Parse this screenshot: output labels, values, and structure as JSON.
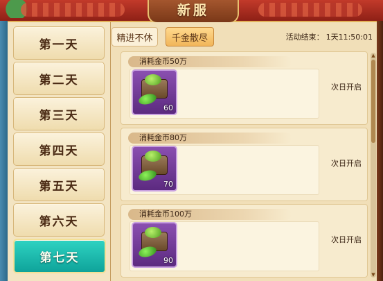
{
  "header": {
    "title": "新服"
  },
  "sidebar": {
    "days": [
      {
        "label": "第一天",
        "active": false
      },
      {
        "label": "第二天",
        "active": false
      },
      {
        "label": "第三天",
        "active": false
      },
      {
        "label": "第四天",
        "active": false
      },
      {
        "label": "第五天",
        "active": false
      },
      {
        "label": "第六天",
        "active": false
      },
      {
        "label": "第七天",
        "active": true
      }
    ]
  },
  "tabs": [
    {
      "label": "精进不休",
      "selected": false
    },
    {
      "label": "千金散尽",
      "selected": true
    }
  ],
  "timer": {
    "label": "活动结束：",
    "value": "1天11:50:01"
  },
  "rewards": [
    {
      "condition": "消耗金币50万",
      "item_count": "60",
      "status": "次日开启"
    },
    {
      "condition": "消耗金币80万",
      "item_count": "70",
      "status": "次日开启"
    },
    {
      "condition": "消耗金币100万",
      "item_count": "90",
      "status": "次日开启"
    }
  ],
  "colors": {
    "active_day": "#1cbcb0",
    "selected_tab": "#f1b65a",
    "panel_bg": "#f1dfb8"
  }
}
